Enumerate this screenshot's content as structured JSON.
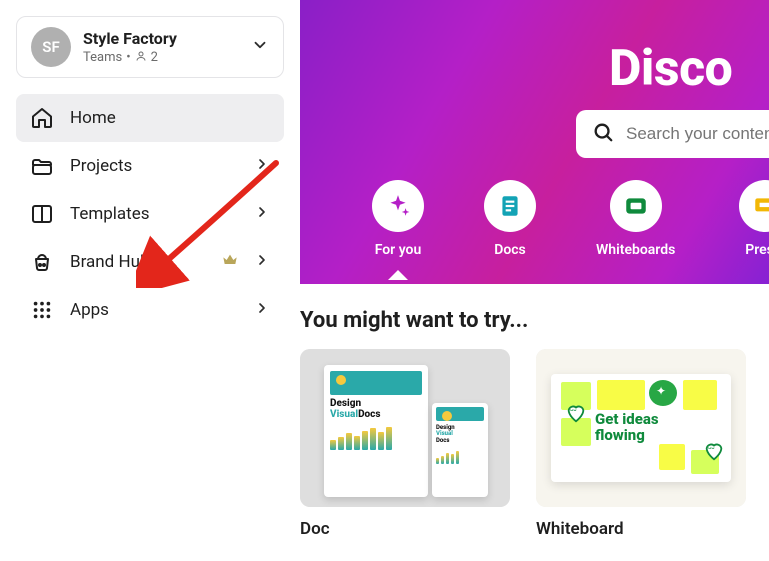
{
  "team": {
    "initials": "SF",
    "name": "Style Factory",
    "plan": "Teams",
    "sep": "•",
    "members": "2"
  },
  "nav": {
    "home": "Home",
    "projects": "Projects",
    "templates": "Templates",
    "brandhub": "Brand Hub",
    "apps": "Apps"
  },
  "hero": {
    "title_partial": "Disco",
    "search_placeholder": "Search your content"
  },
  "doc_types": {
    "foryou": "For you",
    "docs": "Docs",
    "whiteboards": "Whiteboards",
    "presentations_partial": "Prese"
  },
  "section": {
    "title": "You might want to try..."
  },
  "cards": {
    "doc": {
      "label": "Doc",
      "thumb_line1": "Design",
      "thumb_line2a": "Visual",
      "thumb_line2b": "Docs"
    },
    "whiteboard": {
      "label": "Whiteboard",
      "thumb_line1": "Get ideas",
      "thumb_line2": "flowing"
    }
  }
}
